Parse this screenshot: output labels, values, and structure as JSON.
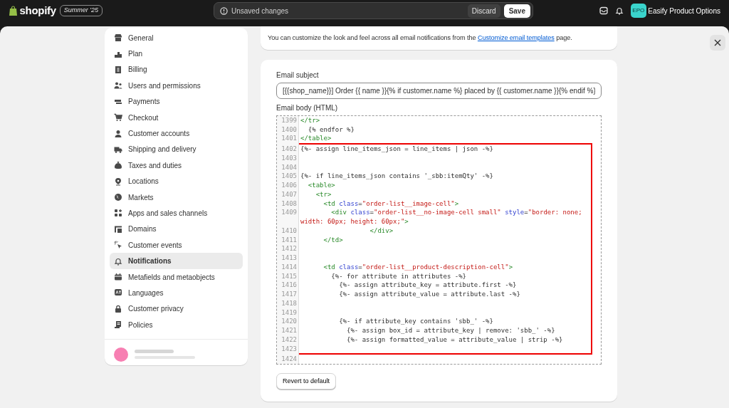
{
  "topbar": {
    "logo": "shopify",
    "edition": "Summer '25",
    "save_bar": {
      "message": "Unsaved changes",
      "discard": "Discard",
      "save": "Save"
    },
    "store": {
      "initials": "EPO",
      "name": "Easify Product Options"
    }
  },
  "sidebar": {
    "items": [
      {
        "label": "General",
        "selected": false
      },
      {
        "label": "Plan",
        "selected": false
      },
      {
        "label": "Billing",
        "selected": false
      },
      {
        "label": "Users and permissions",
        "selected": false
      },
      {
        "label": "Payments",
        "selected": false
      },
      {
        "label": "Checkout",
        "selected": false
      },
      {
        "label": "Customer accounts",
        "selected": false
      },
      {
        "label": "Shipping and delivery",
        "selected": false
      },
      {
        "label": "Taxes and duties",
        "selected": false
      },
      {
        "label": "Locations",
        "selected": false
      },
      {
        "label": "Markets",
        "selected": false
      },
      {
        "label": "Apps and sales channels",
        "selected": false
      },
      {
        "label": "Domains",
        "selected": false
      },
      {
        "label": "Customer events",
        "selected": false
      },
      {
        "label": "Notifications",
        "selected": true
      },
      {
        "label": "Metafields and metaobjects",
        "selected": false
      },
      {
        "label": "Languages",
        "selected": false
      },
      {
        "label": "Customer privacy",
        "selected": false
      },
      {
        "label": "Policies",
        "selected": false
      }
    ]
  },
  "banner": {
    "before": "You can customize the look and feel across all email notifications from the",
    "link": "Customize email templates",
    "after": "page."
  },
  "editor": {
    "subject_label": "Email subject",
    "subject": "[{{shop_name}}] Order {{ name }}{% if customer.name %} placed by {{ customer.name }}{% endif %}",
    "body_label": "Email body (HTML)",
    "revert": "Revert to default",
    "code": {
      "before": [
        {
          "number": "1399",
          "segments": [
            {
              "kind": "tag",
              "text": "</tr>"
            }
          ]
        },
        {
          "number": "1400",
          "segments": [
            {
              "kind": "plain",
              "text": "  {% endfor %}"
            }
          ]
        },
        {
          "number": "1401",
          "segments": [
            {
              "kind": "tag",
              "text": "</table>"
            }
          ]
        }
      ],
      "highlighted": [
        {
          "number": "1402",
          "segments": [
            {
              "kind": "plain",
              "text": "{%- assign line_items_json = line_items | json -%}"
            }
          ]
        },
        {
          "number": "1403"
        },
        {
          "number": "1404"
        },
        {
          "number": "1405",
          "segments": [
            {
              "kind": "plain",
              "text": "{%- if line_items_json contains '_sbb:itemQty' -%}"
            }
          ]
        },
        {
          "number": "1406",
          "segments": [
            {
              "kind": "tag",
              "text": "  <table>"
            }
          ]
        },
        {
          "number": "1407",
          "segments": [
            {
              "kind": "tag",
              "text": "    <tr>"
            }
          ]
        },
        {
          "number": "1408",
          "segments": [
            {
              "kind": "tag",
              "text": "      <td "
            },
            {
              "kind": "attr",
              "text": "class"
            },
            {
              "kind": "plain",
              "text": "="
            },
            {
              "kind": "string",
              "text": "\"order-list__image-cell\""
            },
            {
              "kind": "tag",
              "text": ">"
            }
          ]
        },
        {
          "number": "1409",
          "segments": [
            {
              "kind": "tag",
              "text": "        <div "
            },
            {
              "kind": "attr",
              "text": "class"
            },
            {
              "kind": "plain",
              "text": "="
            },
            {
              "kind": "string",
              "text": "\"order-list__no-image-cell small\""
            },
            {
              "kind": "attr",
              "text": " style"
            },
            {
              "kind": "plain",
              "text": "="
            },
            {
              "kind": "string",
              "text": "\"border: none; width: 60px; height: 60px;\""
            },
            {
              "kind": "tag",
              "text": ">"
            }
          ]
        },
        {
          "number": "1410",
          "segments": [
            {
              "kind": "tag",
              "text": "                  </div>"
            }
          ]
        },
        {
          "number": "1411",
          "segments": [
            {
              "kind": "tag",
              "text": "      </td>"
            }
          ]
        },
        {
          "number": "1412"
        },
        {
          "number": "1413"
        },
        {
          "number": "1414",
          "segments": [
            {
              "kind": "tag",
              "text": "      <td "
            },
            {
              "kind": "attr",
              "text": "class"
            },
            {
              "kind": "plain",
              "text": "="
            },
            {
              "kind": "string",
              "text": "\"order-list__product-description-cell\""
            },
            {
              "kind": "tag",
              "text": ">"
            }
          ]
        },
        {
          "number": "1415",
          "segments": [
            {
              "kind": "plain",
              "text": "        {%- for attribute in attributes -%}"
            }
          ]
        },
        {
          "number": "1416",
          "segments": [
            {
              "kind": "plain",
              "text": "          {%- assign attribute_key = attribute.first -%}"
            }
          ]
        },
        {
          "number": "1417",
          "segments": [
            {
              "kind": "plain",
              "text": "          {%- assign attribute_value = attribute.last -%}"
            }
          ]
        },
        {
          "number": "1418"
        },
        {
          "number": "1419"
        },
        {
          "number": "1420",
          "segments": [
            {
              "kind": "plain",
              "text": "          {%- if attribute_key contains 'sbb_' -%}"
            }
          ]
        },
        {
          "number": "1421",
          "segments": [
            {
              "kind": "plain",
              "text": "            {%- assign box_id = attribute_key | remove: 'sbb_' -%}"
            }
          ]
        },
        {
          "number": "1422",
          "segments": [
            {
              "kind": "plain",
              "text": "            {%- assign formatted_value = attribute_value | strip -%}"
            }
          ]
        },
        {
          "number": "1423"
        }
      ],
      "after": [
        {
          "number": "1424"
        }
      ]
    }
  }
}
